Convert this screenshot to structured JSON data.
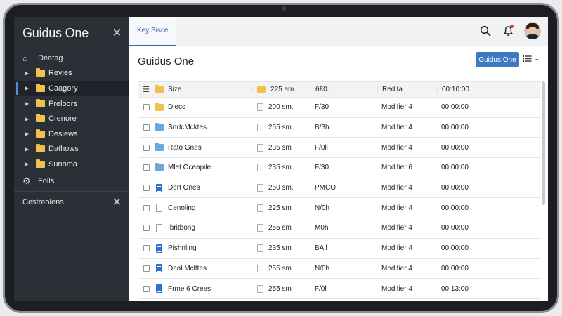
{
  "sidebar": {
    "title": "Guidus One",
    "home": "Deatag",
    "items": [
      {
        "label": "Revies",
        "active": false
      },
      {
        "label": "Caagory",
        "active": true
      },
      {
        "label": "Preloors",
        "active": false
      },
      {
        "label": "Crenore",
        "active": false
      },
      {
        "label": "Desiews",
        "active": false
      },
      {
        "label": "Dathows",
        "active": false
      },
      {
        "label": "Sunoma",
        "active": false
      }
    ],
    "settings": "Folls",
    "section": "Cestreolens"
  },
  "topbar": {
    "tab": "Key Sisce"
  },
  "header": {
    "title": "Guidus One",
    "primary_button": "Guidus One"
  },
  "table": {
    "columns": {
      "name": "Size",
      "size": "225 am",
      "type": "6£0.",
      "modified": "Redita",
      "time": "00:10:00"
    },
    "rows": [
      {
        "icon": "folder-yellow-icon",
        "name": "Dlecc",
        "size": "200 sm.",
        "type": "F/30",
        "modified": "Modifier 4",
        "time": "00:00:00"
      },
      {
        "icon": "folder-blue-icon",
        "name": "SrtdcMcktes",
        "size": "255 sm",
        "type": "B/3h",
        "modified": "Modifier 4",
        "time": "00:00:00"
      },
      {
        "icon": "folder-blue-icon",
        "name": "Rato Gnes",
        "size": "235 sm",
        "type": "F/0li",
        "modified": "Modifier 4",
        "time": "00:00:00"
      },
      {
        "icon": "folder-blue-icon",
        "name": "Mlet Oceapile",
        "size": "235 sm",
        "type": "F/30",
        "modified": "Modifier 6",
        "time": "00:00:00"
      },
      {
        "icon": "doc-icon",
        "name": "Dert Ones",
        "size": "250 sm.",
        "type": "PMCO",
        "modified": "Modifier 4",
        "time": "00:00:00"
      },
      {
        "icon": "page-icon",
        "name": "Cenoling",
        "size": "225 sm",
        "type": "N/0h",
        "modified": "Modifier 4",
        "time": "00:00:00"
      },
      {
        "icon": "page-icon",
        "name": "Ibritbong",
        "size": "255 sm",
        "type": "M0h",
        "modified": "Modifier 4",
        "time": "00:00:00"
      },
      {
        "icon": "doc-icon",
        "name": "Pishnling",
        "size": "235 sm",
        "type": "BAll",
        "modified": "Modifier 4",
        "time": "00:00:00"
      },
      {
        "icon": "doc-icon",
        "name": "Deal Mclttes",
        "size": "255 sm",
        "type": "N/0h",
        "modified": "Modifier 4",
        "time": "00:00:00"
      },
      {
        "icon": "doc-icon",
        "name": "Frme 6 Crees",
        "size": "255 sm",
        "type": "F/0l",
        "modified": "Modifier 4",
        "time": "00:13:00"
      }
    ]
  }
}
